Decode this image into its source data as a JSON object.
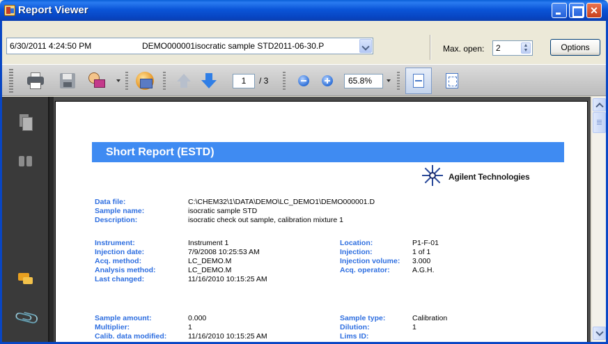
{
  "window": {
    "title": "Report Viewer"
  },
  "doc_select": {
    "date": "6/30/2011 4:24:50 PM",
    "filename": "DEMO000001isocratic sample STD2011-06-30.P"
  },
  "max_open": {
    "label": "Max. open:",
    "value": "2"
  },
  "options_label": "Options",
  "toolbar": {
    "page_current": "1",
    "page_total": "/ 3",
    "zoom": "65.8%"
  },
  "report": {
    "banner": "Short Report (ESTD)",
    "logo_text": "Agilent Technologies",
    "fields_top": [
      {
        "label": "Data file:",
        "value": "C:\\CHEM32\\1\\DATA\\DEMO\\LC_DEMO1\\DEMO000001.D"
      },
      {
        "label": "Sample name:",
        "value": "isocratic sample STD"
      },
      {
        "label": "Description:",
        "value": "isocratic check out sample, calibration mixture 1"
      }
    ],
    "fields_mid_left": [
      {
        "label": "Instrument:",
        "value": "Instrument 1"
      },
      {
        "label": "Injection date:",
        "value": "7/9/2008 10:25:53 AM"
      },
      {
        "label": "Acq. method:",
        "value": "LC_DEMO.M"
      },
      {
        "label": "Analysis method:",
        "value": "LC_DEMO.M"
      },
      {
        "label": "Last changed:",
        "value": "11/16/2010 10:15:25 AM"
      }
    ],
    "fields_mid_right": [
      {
        "label": "Location:",
        "value": "P1-F-01"
      },
      {
        "label": "Injection:",
        "value": "1 of 1"
      },
      {
        "label": "Injection volume:",
        "value": "3.000"
      },
      {
        "label": "Acq. operator:",
        "value": "A.G.H."
      }
    ],
    "fields_bottom_left": [
      {
        "label": "Sample amount:",
        "value": "0.000"
      },
      {
        "label": "Multiplier:",
        "value": "1"
      },
      {
        "label": "Calib. data modified:",
        "value": "11/16/2010 10:15:25 AM"
      }
    ],
    "fields_bottom_right": [
      {
        "label": "Sample type:",
        "value": "Calibration"
      },
      {
        "label": "Dilution:",
        "value": "1"
      },
      {
        "label": "Lims ID:",
        "value": ""
      }
    ]
  }
}
